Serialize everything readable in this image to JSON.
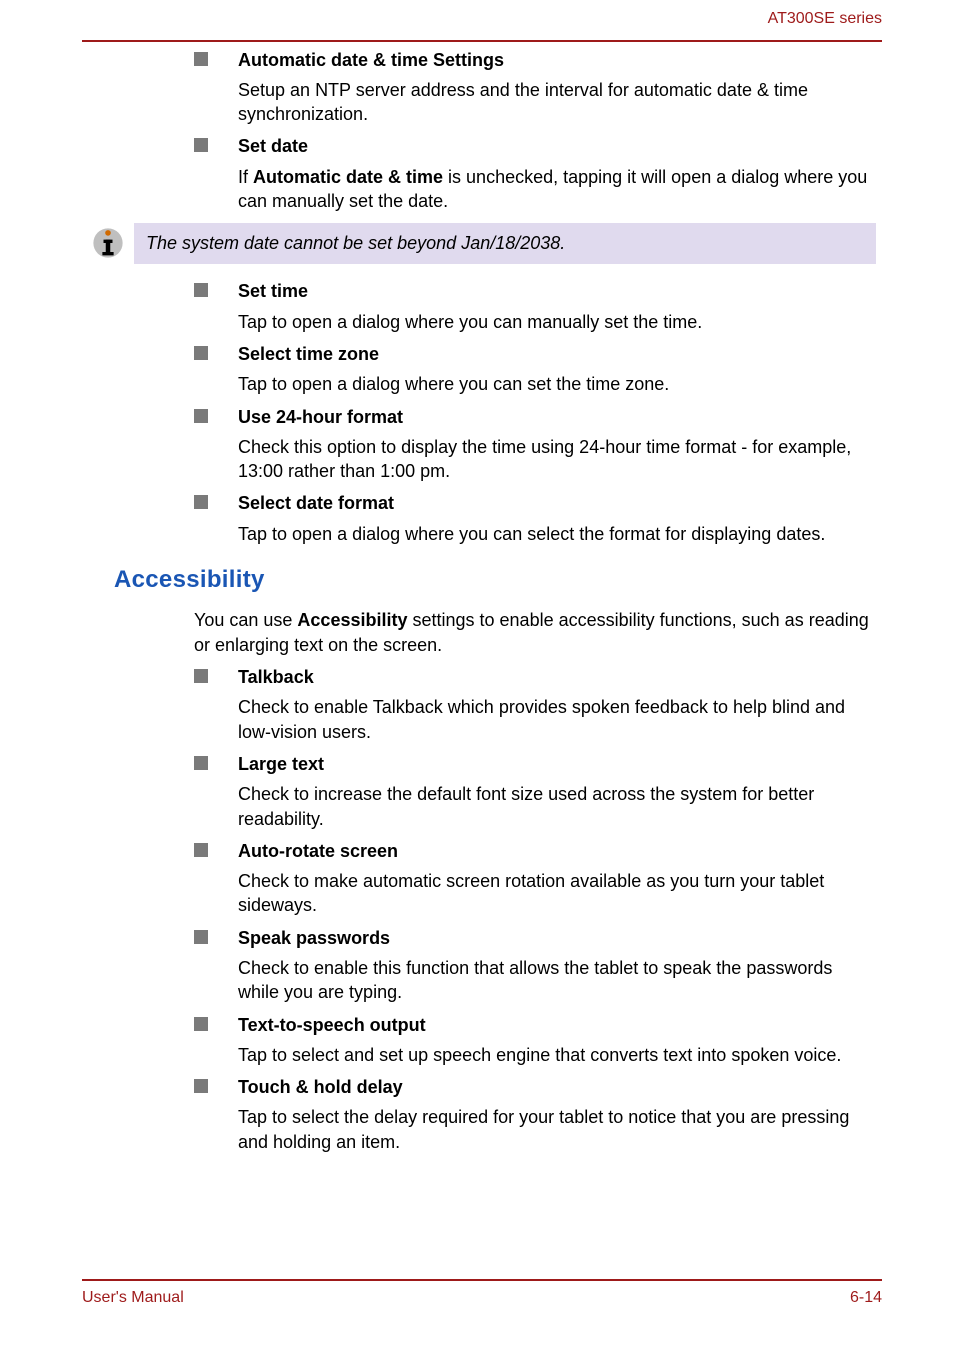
{
  "header": {
    "series": "AT300SE series"
  },
  "datetime": {
    "items": [
      {
        "title": "Automatic date & time Settings",
        "body": "Setup an NTP server address and the interval for automatic date & time synchronization."
      },
      {
        "title": "Set date",
        "body_pre": "If ",
        "body_bold": "Automatic date & time",
        "body_post": " is unchecked, tapping it will open a dialog where you can manually set the date."
      }
    ],
    "note": "The system date cannot be set beyond Jan/18/2038.",
    "items2": [
      {
        "title": "Set time",
        "body": "Tap to open a dialog where you can manually set the time."
      },
      {
        "title": "Select time zone",
        "body": "Tap to open a dialog where you can set the time zone."
      },
      {
        "title": "Use 24-hour format",
        "body": "Check this option to display the time using 24-hour time format - for example, 13:00 rather than 1:00 pm."
      },
      {
        "title": "Select date format",
        "body": "Tap to open a dialog where you can select the format for displaying dates."
      }
    ]
  },
  "accessibility": {
    "heading": "Accessibility",
    "intro_pre": "You can use ",
    "intro_bold": "Accessibility",
    "intro_post": " settings to enable accessibility functions, such as reading or enlarging text on the screen.",
    "items": [
      {
        "title": "Talkback",
        "body": "Check to enable Talkback which provides spoken feedback to help blind and low-vision users."
      },
      {
        "title": "Large text",
        "body": "Check to increase the default font size used across the system for better readability."
      },
      {
        "title": "Auto-rotate screen",
        "body": "Check to make automatic screen rotation available as you turn your tablet sideways."
      },
      {
        "title": "Speak passwords",
        "body": "Check to enable this function that allows the tablet to speak the passwords while you are typing."
      },
      {
        "title": "Text-to-speech output",
        "body": "Tap to select and set up speech engine that converts text into spoken voice."
      },
      {
        "title": "Touch & hold delay",
        "body": "Tap to select the delay required for your tablet to notice that you are pressing and holding an item."
      }
    ]
  },
  "footer": {
    "left": "User's Manual",
    "right": "6-14"
  }
}
